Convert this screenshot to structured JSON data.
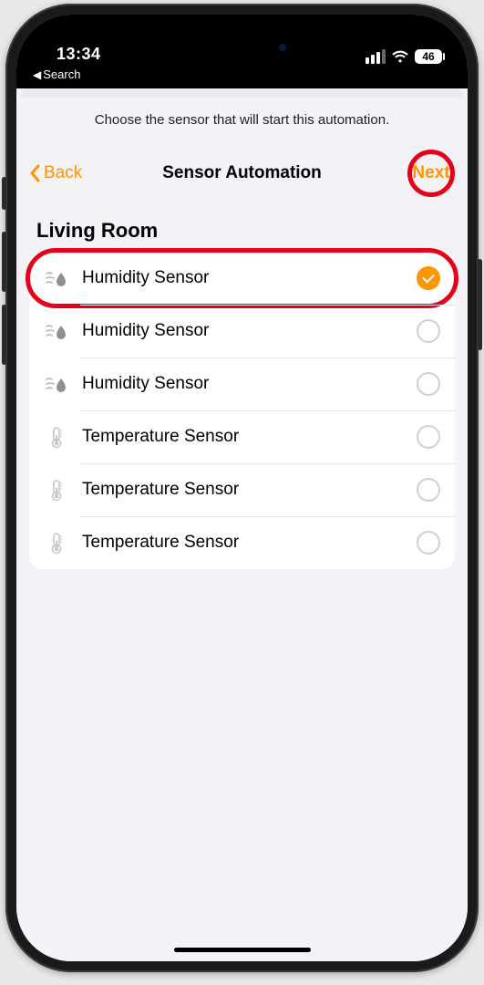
{
  "status": {
    "time": "13:34",
    "breadcrumb": "Search",
    "battery": "46"
  },
  "instruction": "Choose the sensor that will start this automation.",
  "nav": {
    "back": "Back",
    "title": "Sensor Automation",
    "next": "Next"
  },
  "section": "Living Room",
  "sensors": [
    {
      "label": "Humidity Sensor",
      "type": "humidity",
      "selected": true
    },
    {
      "label": "Humidity Sensor",
      "type": "humidity",
      "selected": false
    },
    {
      "label": "Humidity Sensor",
      "type": "humidity",
      "selected": false
    },
    {
      "label": "Temperature Sensor",
      "type": "temperature",
      "selected": false
    },
    {
      "label": "Temperature Sensor",
      "type": "temperature",
      "selected": false
    },
    {
      "label": "Temperature Sensor",
      "type": "temperature",
      "selected": false
    }
  ],
  "annotations": {
    "highlight_first_row": true,
    "highlight_next": true
  },
  "icons": {
    "humidity": "humidity-icon",
    "temperature": "temperature-icon"
  }
}
